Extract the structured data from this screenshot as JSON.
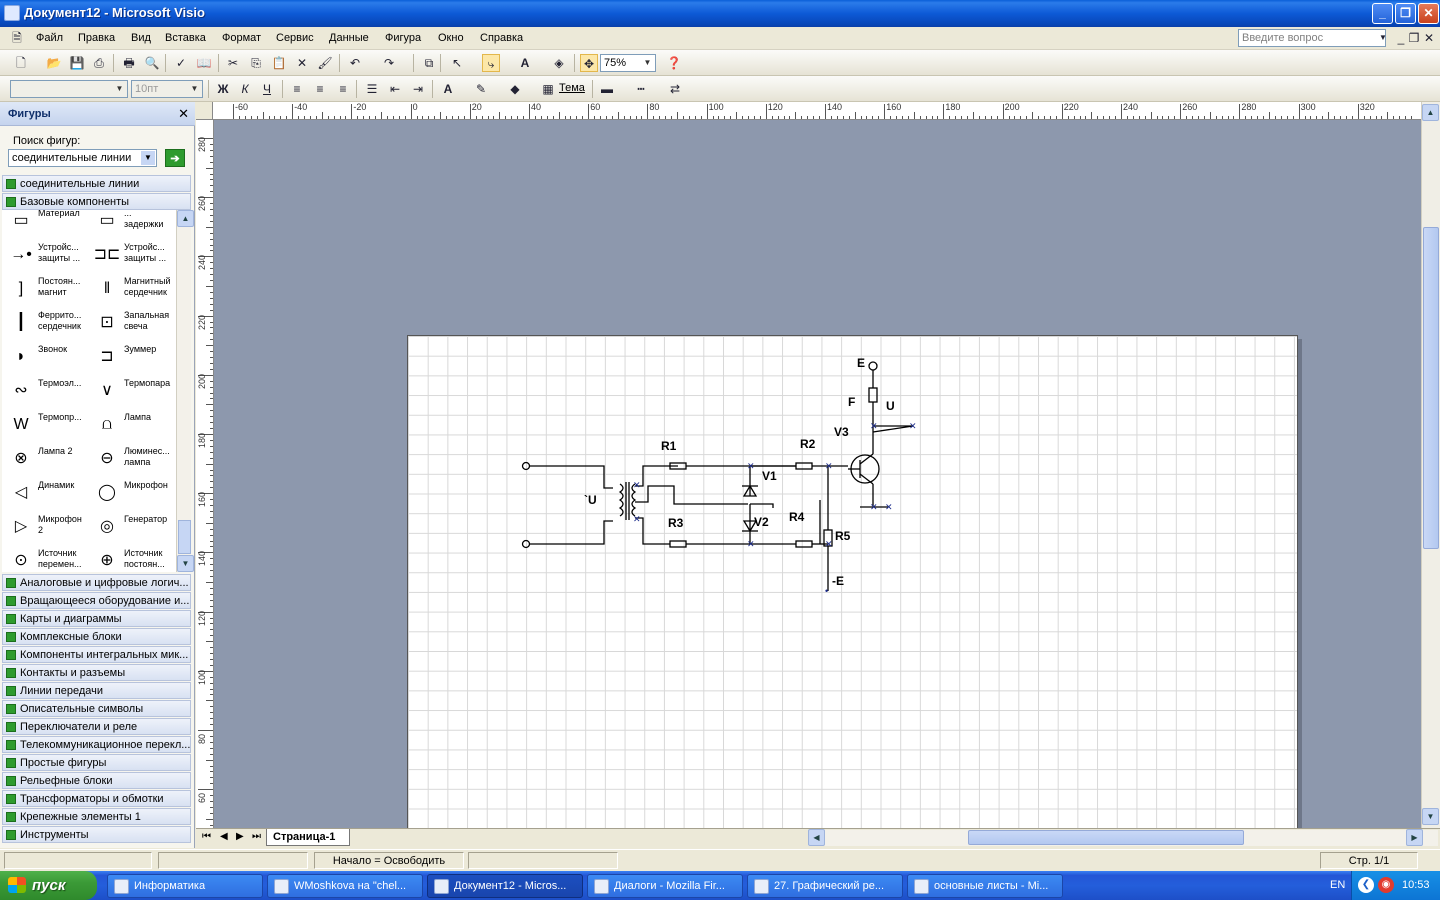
{
  "window": {
    "title": "Документ12 - Microsoft Visio"
  },
  "menu": {
    "items": [
      "Файл",
      "Правка",
      "Вид",
      "Вставка",
      "Формат",
      "Сервис",
      "Данные",
      "Фигура",
      "Окно",
      "Справка"
    ],
    "help_placeholder": "Введите вопрос"
  },
  "toolbar": {
    "zoom": "75%",
    "theme_label": "Тема",
    "font_size": "10пт",
    "font_name": ""
  },
  "panel": {
    "title": "Фигуры",
    "search_label": "Поиск фигур:",
    "search_value": "соединительные линии",
    "stencils_top": [
      "соединительные линии",
      "Базовые компоненты"
    ],
    "shapes": [
      {
        "label": "Материал",
        "icon": "material-icon"
      },
      {
        "label": "... задержки",
        "icon": "delay-icon"
      },
      {
        "label": "Устройс... защиты ...",
        "icon": "protection-device-icon"
      },
      {
        "label": "Устройс... защиты ...",
        "icon": "protection-device-2-icon"
      },
      {
        "label": "Постоян... магнит",
        "icon": "permanent-magnet-icon"
      },
      {
        "label": "Магнитный сердечник",
        "icon": "magnetic-core-icon"
      },
      {
        "label": "Феррито... сердечник",
        "icon": "ferrite-core-icon"
      },
      {
        "label": "Запальная свеча",
        "icon": "spark-plug-icon"
      },
      {
        "label": "Звонок",
        "icon": "bell-icon"
      },
      {
        "label": "Зуммер",
        "icon": "buzzer-icon"
      },
      {
        "label": "Термоэл...",
        "icon": "thermoelement-icon"
      },
      {
        "label": "Термопара",
        "icon": "thermocouple-icon"
      },
      {
        "label": "Термопр...",
        "icon": "thermistor-icon"
      },
      {
        "label": "Лампа",
        "icon": "lamp-icon"
      },
      {
        "label": "Лампа 2",
        "icon": "lamp-2-icon"
      },
      {
        "label": "Люминес... лампа",
        "icon": "fluorescent-lamp-icon"
      },
      {
        "label": "Динамик",
        "icon": "speaker-icon"
      },
      {
        "label": "Микрофон",
        "icon": "microphone-icon"
      },
      {
        "label": "Микрофон 2",
        "icon": "microphone-2-icon"
      },
      {
        "label": "Генератор",
        "icon": "generator-icon"
      },
      {
        "label": "Источник перемен...",
        "icon": "ac-source-icon"
      },
      {
        "label": "Источник постоян...",
        "icon": "dc-source-icon"
      }
    ],
    "stencils_bottom": [
      "Аналоговые и цифровые логич...",
      "Вращающееся оборудование и...",
      "Карты и диаграммы",
      "Комплексные блоки",
      "Компоненты интегральных мик...",
      "Контакты и разъемы",
      "Линии передачи",
      "Описательные символы",
      "Переключатели и реле",
      "Телекоммуникационное перекл...",
      "Простые фигуры",
      "Рельефные блоки",
      "Трансформаторы и обмотки",
      "Крепежные элементы 1",
      "Инструменты"
    ]
  },
  "ruler": {
    "h_labels": [
      "-60",
      "-40",
      "-20",
      "0",
      "20",
      "40",
      "60",
      "80",
      "100",
      "120",
      "140",
      "160",
      "180",
      "200",
      "220",
      "240",
      "260",
      "280",
      "300",
      "320"
    ],
    "v_labels": [
      "280",
      "260",
      "240",
      "220",
      "200",
      "180",
      "160",
      "140",
      "120",
      "100",
      "80",
      "60"
    ]
  },
  "diagram": {
    "labels": {
      "E": "E",
      "F": "F",
      "U": "U",
      "V3": "V3",
      "R1": "R1",
      "R2": "R2",
      "V1": "V1",
      "U_in": "`U",
      "R3": "R3",
      "V2": "V2",
      "R4": "R4",
      "R5": "R5",
      "minusE": "-E"
    }
  },
  "tabs": {
    "page": "Страница-1"
  },
  "status": {
    "main": "Начало = Освободить",
    "page": "Стр. 1/1"
  },
  "taskbar": {
    "start": "пуск",
    "tasks": [
      "Информатика",
      "WMoshkova на \"chel...",
      "Документ12 - Micros...",
      "Диалоги - Mozilla Fir...",
      "27. Графический ре...",
      "основные листы - Mi..."
    ],
    "lang": "EN",
    "clock": "10:53"
  },
  "colors": {
    "canvas_bg": "#8d98ad",
    "titlebar": "#0a5fd8",
    "taskbar": "#245edb",
    "start": "#3b9a37"
  }
}
